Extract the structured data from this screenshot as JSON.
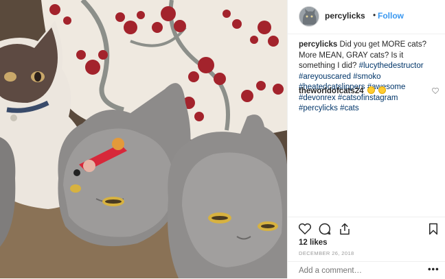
{
  "post": {
    "username": "percylicks",
    "separator": "•",
    "follow_label": "Follow",
    "caption": {
      "username": "percylicks",
      "text": "Did you get MORE cats? More MEAN, GRAY cats? Is it something I did?",
      "hashtags": [
        "#lucythedestructor",
        "#areyouscared",
        "#smoko",
        "#heatedcatslippers",
        "#awesome",
        "#devonrex",
        "#catsofinstagram",
        "#percylicks",
        "#cats"
      ]
    },
    "comments": [
      {
        "username": "theworldofcats24",
        "emojis": [
          "grinning-face-emoji",
          "smiling-face-emoji"
        ]
      }
    ],
    "likes": "12 likes",
    "date": "DECEMBER 26, 2018",
    "comment_placeholder": "Add a comment…",
    "more_label": "•••"
  },
  "icons": {
    "like": "heart-icon",
    "comment": "comment-bubble-icon",
    "share": "share-icon",
    "save": "bookmark-icon",
    "comment_like": "heart-icon"
  },
  "colors": {
    "follow": "#3897f0",
    "hashtag": "#003569",
    "text": "#262626",
    "muted": "#999999",
    "divider": "#efefef"
  }
}
